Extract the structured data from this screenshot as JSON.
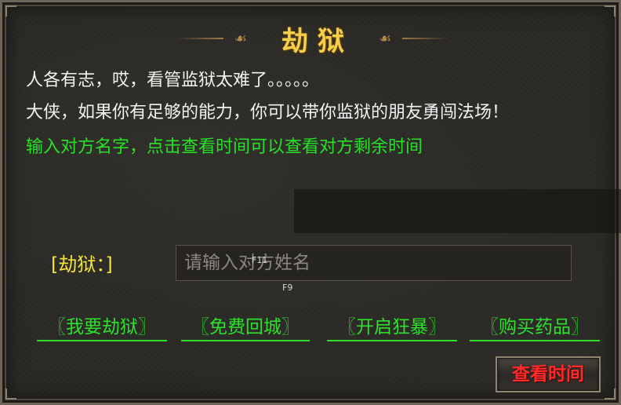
{
  "title": "劫狱",
  "title_ornament": "☙",
  "description": {
    "line1": "人各有志，哎，看管监狱太难了。。。。。",
    "line2": "大侠，如果你有足够的能力，你可以带你监狱的朋友勇闯法场！",
    "hint": "输入对方名字，点击查看时间可以查看对方剩余时间"
  },
  "form": {
    "label": "[劫狱：]",
    "input_value": "",
    "input_placeholder": "请输入对方姓名",
    "hotkey_top": "F11",
    "hotkey_bottom": "F9"
  },
  "actions": [
    {
      "label": "〖我要劫狱〗"
    },
    {
      "label": "〖免费回城〗"
    },
    {
      "label": "〖开启狂暴〗"
    },
    {
      "label": "〖购买药品〗"
    }
  ],
  "check_time_button": "查看时间",
  "colors": {
    "title": "#f5cf4a",
    "hint": "#27e127",
    "label": "#f5e23a",
    "action": "#2de02d",
    "button_text": "#ff2a2a"
  }
}
